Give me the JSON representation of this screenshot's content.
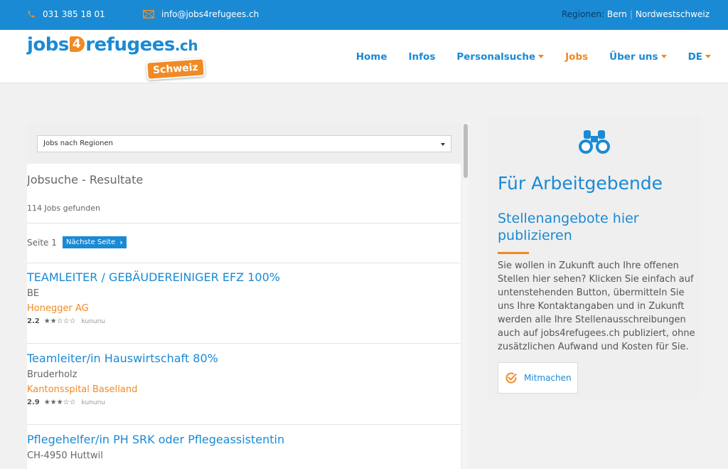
{
  "topbar": {
    "phone": "031 385 18 01",
    "email": "info@jobs4refugees.ch",
    "regions_label": "Regionen:",
    "regions": [
      "Bern",
      "Nordwestschweiz"
    ]
  },
  "logo": {
    "part1": "jobs",
    "part2": "4",
    "part3": "refugees",
    "part4": ".ch",
    "badge": "Schweiz"
  },
  "nav": [
    {
      "label": "Home",
      "dropdown": false,
      "active": false
    },
    {
      "label": "Infos",
      "dropdown": false,
      "active": false
    },
    {
      "label": "Personalsuche",
      "dropdown": true,
      "active": false
    },
    {
      "label": "Jobs",
      "dropdown": false,
      "active": true
    },
    {
      "label": "Über uns",
      "dropdown": true,
      "active": false
    },
    {
      "label": "DE",
      "dropdown": true,
      "active": false
    }
  ],
  "filter": {
    "selected": "Jobs nach Regionen"
  },
  "results": {
    "title": "Jobsuche - Resultate",
    "count": "114 Jobs gefunden",
    "page_label": "Seite 1",
    "next_label": "Nächste Seite"
  },
  "jobs": [
    {
      "title": "TEAMLEITER / GEBÄUDEREINIGER EFZ 100%",
      "location": "BE",
      "company": "Honegger AG",
      "rating": "2.2",
      "stars": 2,
      "source": "kununu"
    },
    {
      "title": "Teamleiter/in Hauswirtschaft 80%",
      "location": "Bruderholz",
      "company": "Kantonsspital Baselland",
      "rating": "2.9",
      "stars": 3,
      "source": "kununu"
    },
    {
      "title": "Pflegehelfer/in PH SRK oder Pflegeassistentin",
      "location": "CH-4950 Huttwil",
      "company": "",
      "rating": "",
      "stars": 0,
      "source": ""
    }
  ],
  "employers": {
    "title": "Für Arbeitgebende",
    "subtitle": "Stellenangebote hier publizieren",
    "body": "Sie wollen in Zukunft auch Ihre offenen Stellen hier sehen? Klicken Sie einfach auf untenstehenden Button, übermitteln Sie uns Ihre Kontaktangaben und in Zukunft werden alle Ihre Stellenausschreibungen auch auf jobs4refugees.ch publiziert, ohne zusätzlichen Aufwand und Kosten für Sie.",
    "button": "Mitmachen"
  },
  "colors": {
    "primary": "#1a8ad4",
    "accent": "#f08a24"
  }
}
